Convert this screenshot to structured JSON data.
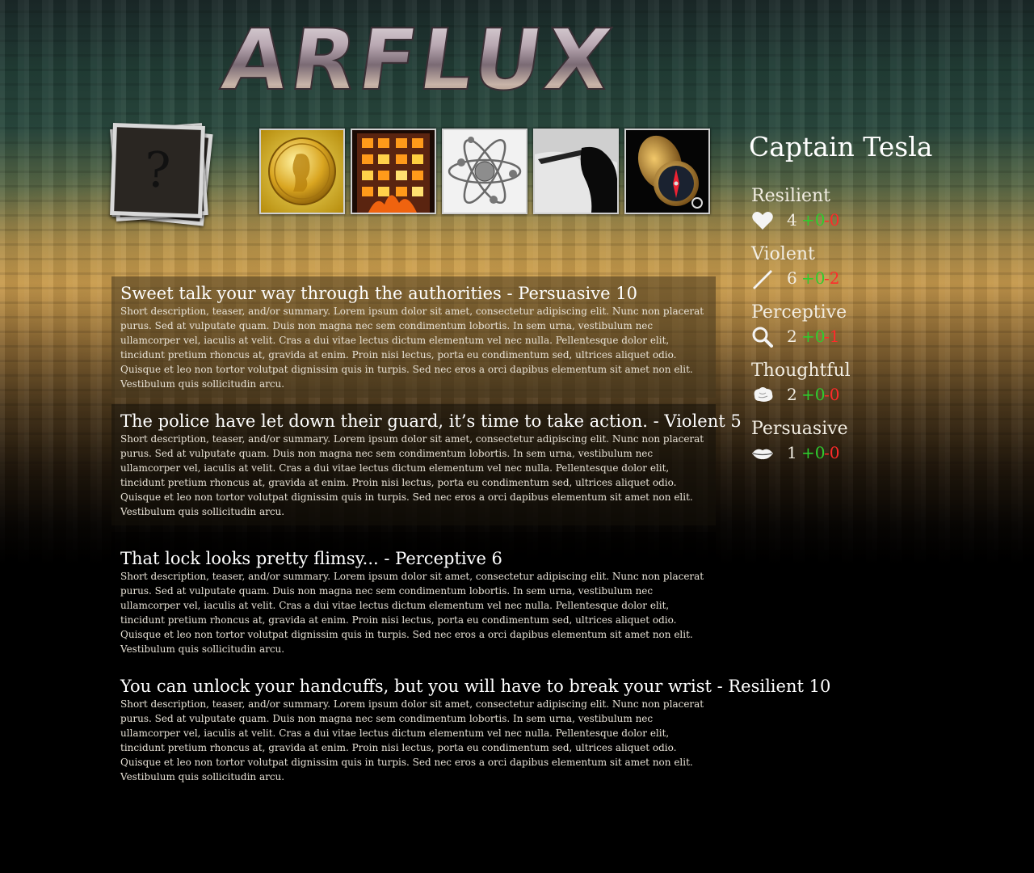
{
  "logo": {
    "text": "ARFLUX"
  },
  "deck": {
    "symbol": "?"
  },
  "items": [
    {
      "icon": "gold-coin-icon"
    },
    {
      "icon": "burning-building-icon"
    },
    {
      "icon": "atom-icon"
    },
    {
      "icon": "knife-hand-icon"
    },
    {
      "icon": "compass-icon"
    }
  ],
  "events": [
    {
      "title": "Sweet talk your way through the authorities - Persuasive 10",
      "description": "Short description, teaser, and/or summary. Lorem ipsum dolor sit amet, consectetur adipiscing elit. Nunc non placerat purus. Sed at vulputate quam. Duis non magna nec sem condimentum lobortis. In sem urna, vestibulum nec ullamcorper vel, iaculis at velit. Cras a dui vitae lectus dictum elementum vel nec nulla. Pellentesque dolor elit, tincidunt pretium rhoncus at, gravida at enim. Proin nisi lectus, porta eu condimentum sed, ultrices aliquet odio. Quisque et leo non tortor volutpat dignissim quis in turpis. Sed nec eros a orci dapibus elementum sit amet non elit. Vestibulum quis sollicitudin arcu."
    },
    {
      "title": "The police have let down their guard, it’s time to take action. - Violent 5",
      "description": "Short description, teaser, and/or summary. Lorem ipsum dolor sit amet, consectetur adipiscing elit. Nunc non placerat purus. Sed at vulputate quam. Duis non magna nec sem condimentum lobortis. In sem urna, vestibulum nec ullamcorper vel, iaculis at velit. Cras a dui vitae lectus dictum elementum vel nec nulla. Pellentesque dolor elit, tincidunt pretium rhoncus at, gravida at enim. Proin nisi lectus, porta eu condimentum sed, ultrices aliquet odio. Quisque et leo non tortor volutpat dignissim quis in turpis. Sed nec eros a orci dapibus elementum sit amet non elit. Vestibulum quis sollicitudin arcu."
    },
    {
      "title": "That lock looks pretty flimsy... - Perceptive 6",
      "description": "Short description, teaser, and/or summary. Lorem ipsum dolor sit amet, consectetur adipiscing elit. Nunc non placerat purus. Sed at vulputate quam. Duis non magna nec sem condimentum lobortis. In sem urna, vestibulum nec ullamcorper vel, iaculis at velit. Cras a dui vitae lectus dictum elementum vel nec nulla. Pellentesque dolor elit, tincidunt pretium rhoncus at, gravida at enim. Proin nisi lectus, porta eu condimentum sed, ultrices aliquet odio. Quisque et leo non tortor volutpat dignissim quis in turpis. Sed nec eros a orci dapibus elementum sit amet non elit. Vestibulum quis sollicitudin arcu."
    },
    {
      "title": "You can unlock your handcuffs, but you will have to break your wrist - Resilient 10",
      "description": "Short description, teaser, and/or summary. Lorem ipsum dolor sit amet, consectetur adipiscing elit. Nunc non placerat purus. Sed at vulputate quam. Duis non magna nec sem condimentum lobortis. In sem urna, vestibulum nec ullamcorper vel, iaculis at velit. Cras a dui vitae lectus dictum elementum vel nec nulla. Pellentesque dolor elit, tincidunt pretium rhoncus at, gravida at enim. Proin nisi lectus, porta eu condimentum sed, ultrices aliquet odio. Quisque et leo non tortor volutpat dignissim quis in turpis. Sed nec eros a orci dapibus elementum sit amet non elit. Vestibulum quis sollicitudin arcu."
    }
  ],
  "character": {
    "name": "Captain Tesla",
    "stats": [
      {
        "label": "Resilient",
        "icon": "heart-icon",
        "value": "4",
        "plus": "+0",
        "minus": "-0"
      },
      {
        "label": "Violent",
        "icon": "knife-icon",
        "value": "6",
        "plus": "+0",
        "minus": "-2"
      },
      {
        "label": "Perceptive",
        "icon": "magnifier-icon",
        "value": "2",
        "plus": "+0",
        "minus": "-1"
      },
      {
        "label": "Thoughtful",
        "icon": "brain-icon",
        "value": "2",
        "plus": "+0",
        "minus": "-0"
      },
      {
        "label": "Persuasive",
        "icon": "lips-icon",
        "value": "1",
        "plus": "+0",
        "minus": "-0"
      }
    ]
  },
  "colors": {
    "bonus": "#2ecc2e",
    "penalty": "#ff2a2a"
  }
}
